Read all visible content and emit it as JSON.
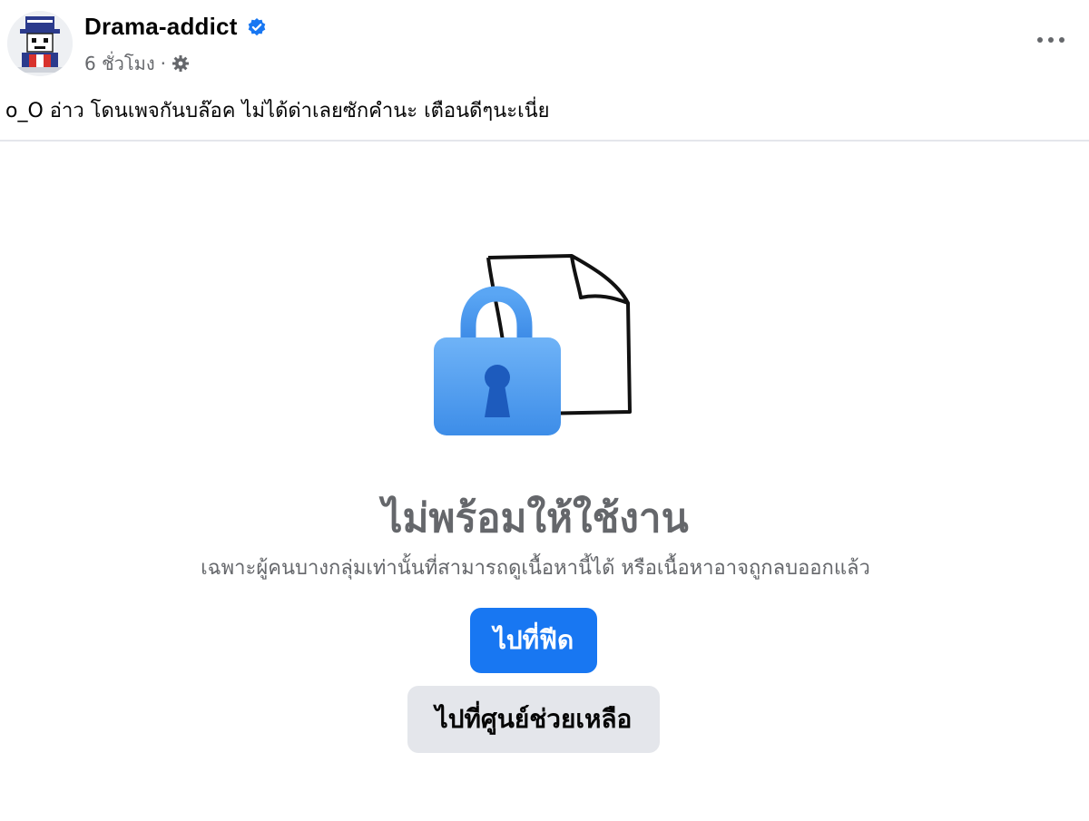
{
  "post": {
    "author": "Drama-addict",
    "timestamp": "6 ชั่วโมง",
    "separator": "·",
    "caption": "o_O อ่าว โดนเพจกันบล๊อค ไม่ได้ด่าเลยซักคำนะ เตือนดีๆนะเนี่ย",
    "verified_icon": "verified-badge-icon",
    "audience_icon": "gear-icon",
    "more_icon": "more-options-icon"
  },
  "unavailable": {
    "title": "ไม่พร้อมให้ใช้งาน",
    "description": "เฉพาะผู้คนบางกลุ่มเท่านั้นที่สามารถดูเนื้อหานี้ได้ หรือเนื้อหาอาจถูกลบออกแล้ว",
    "primary_button": "ไปที่ฟีด",
    "secondary_button": "ไปที่ศูนย์ช่วยเหลือ",
    "illustration_icon": "lock-document-icon"
  },
  "colors": {
    "accent": "#1877f2",
    "secondary_button_bg": "#e4e6eb",
    "muted_text": "#65676b",
    "lock_blue": "#4a9cf0"
  }
}
